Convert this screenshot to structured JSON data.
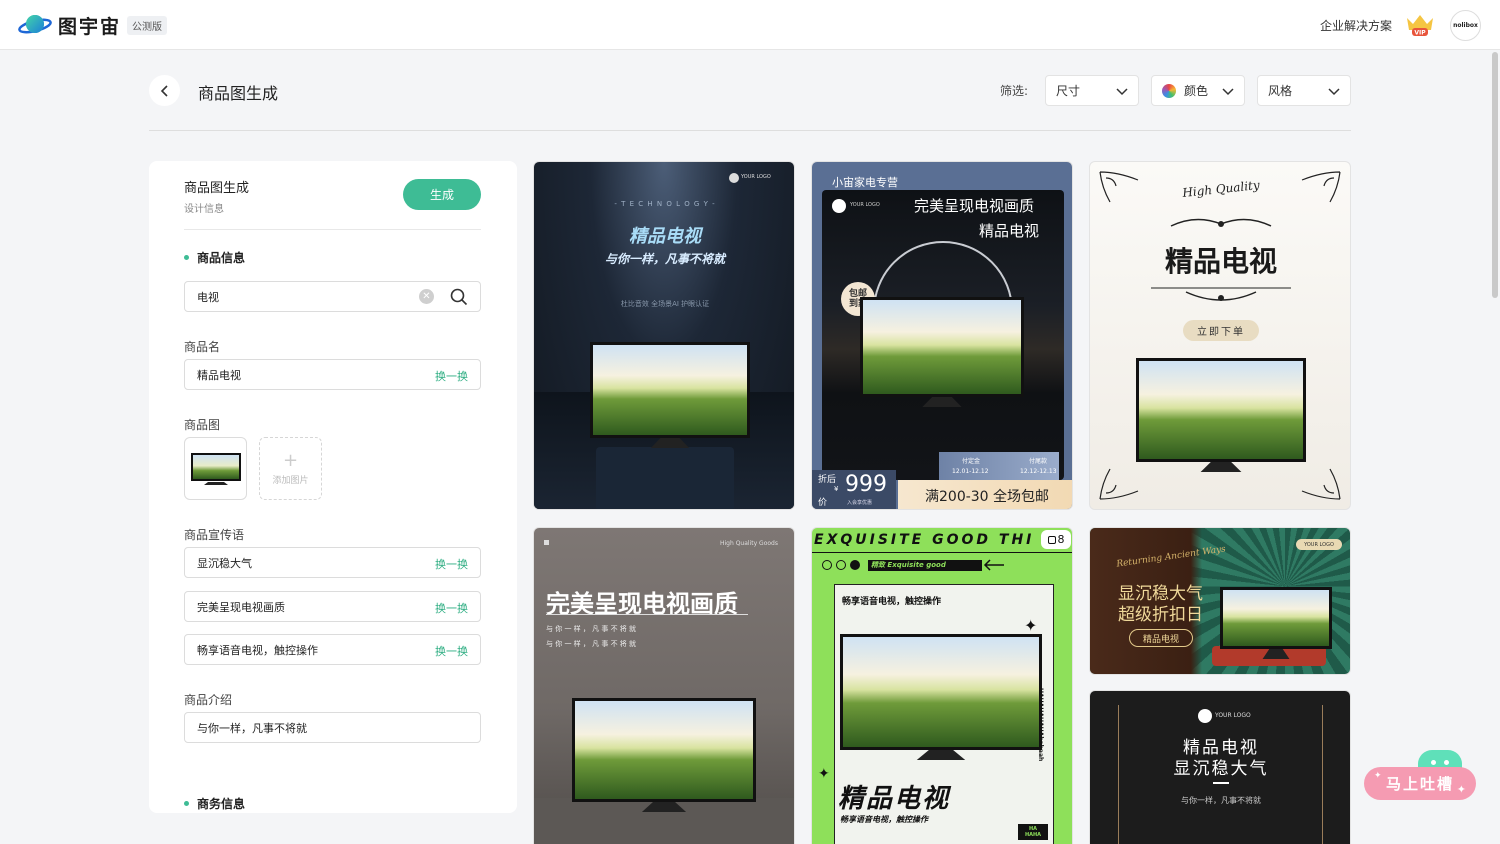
{
  "app": {
    "name": "图宇宙",
    "badge": "公测版",
    "enterprise": "企业解决方案",
    "vip": "VIP",
    "avatar_text": "nolibox"
  },
  "header": {
    "title": "商品图生成",
    "filter_label": "筛选:",
    "filters": [
      "尺寸",
      "颜色",
      "风格"
    ]
  },
  "panel": {
    "title": "商品图生成",
    "subtitle": "设计信息",
    "generate": "生成",
    "section_product": "商品信息",
    "search_value": "电视",
    "name_label": "商品名",
    "name_value": "精品电视",
    "swap": "换一换",
    "image_label": "商品图",
    "add_image": "添加图片",
    "slogan_label": "商品宣传语",
    "slogans": [
      "显沉稳大气",
      "完美呈现电视画质",
      "畅享语音电视，触控操作"
    ],
    "intro_label": "商品介绍",
    "intro_value": "与你一样，凡事不将就",
    "section_business": "商务信息"
  },
  "cards": {
    "c1": {
      "logo": "YOUR LOGO",
      "eyebrow": "- T E C H N O L O G Y -",
      "title": "精品电视",
      "subtitle": "与你一样，凡事不将就",
      "features": "杜比音效  全场景AI  护眼认证"
    },
    "c2": {
      "tag": "小宙家电专营",
      "logo": "YOUR LOGO",
      "headline": "完美呈现电视画质",
      "name": "精品电视",
      "badge_a": "包邮",
      "badge_b": "到家",
      "deposit": "付定金",
      "deposit_date": "12.01-12.12",
      "final": "付尾款",
      "final_date": "12.12-12.13",
      "price_label_a": "折后",
      "price_label_b": "价",
      "price": "999",
      "currency": "¥",
      "member": "入会享优惠",
      "promo": "满200-30 全场包邮"
    },
    "c3": {
      "script": "High Quality",
      "title": "精品电视",
      "button": "立即下单"
    },
    "c4": {
      "brand": "High Quality Goods",
      "title": "完美呈现电视画质",
      "line1": "与 你 一 样 ， 凡 事 不 将 就",
      "line2": "与 你 一 样 ， 凡 事 不 将 就"
    },
    "c5": {
      "ticker": "EXQUISITE GOOD THI",
      "counter": "8",
      "tagline": "精致 Exquisite good",
      "slogan": "畅享语音电视，触控操作",
      "side": "HAHAHAHAHAhahaah",
      "big": "精品电视",
      "bottom": "畅享语音电视，触控操作",
      "stamp_a": "HA",
      "stamp_b": "HAHA"
    },
    "c6": {
      "script": "Returning Ancient Ways",
      "logo": "YOUR LOGO",
      "line1": "显沉稳大气",
      "line2": "超级折扣日",
      "pill": "精品电视"
    },
    "c7": {
      "logo": "YOUR LOGO",
      "line1": "精品电视",
      "line2": "显沉稳大气",
      "foot": "与你一样，凡事不将就"
    }
  },
  "feedback": {
    "label": "马上吐槽"
  },
  "colors": {
    "accent": "#3ebc95",
    "swap": "#2fae83",
    "feedback": "#f59bb2",
    "lime": "#8ee05a"
  }
}
